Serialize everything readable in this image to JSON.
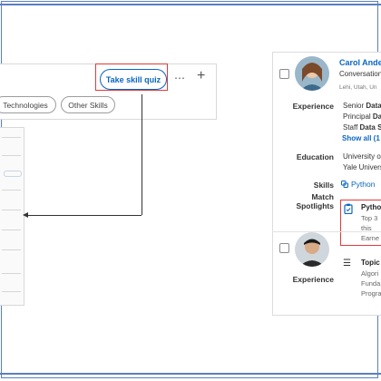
{
  "toolbar": {
    "quiz_button": "Take skill quiz",
    "more_symbol": "⋯",
    "plus_symbol": "+"
  },
  "skill_chips": [
    "Technologies",
    "Other Skills"
  ],
  "profile_1": {
    "name": "Carol Ande",
    "headline": "Conversation",
    "location": "Lehi, Utah, Un",
    "experience_label": "Experience",
    "experience": [
      {
        "prefix": "Senior ",
        "bold": "Data"
      },
      {
        "prefix": "Principal ",
        "bold": "Da"
      },
      {
        "prefix": "Staff ",
        "bold": "Data S"
      }
    ],
    "show_all": "Show all (1",
    "education_label": "Education",
    "education": [
      "University o",
      "Yale Univers"
    ],
    "skills_label": "Skills",
    "skill": "Python",
    "match_label_1": "Match",
    "match_label_2": "Spotlights",
    "spotlight": {
      "title": "Pytho",
      "lines": [
        "Top 3",
        "this",
        "Earne"
      ]
    }
  },
  "profile_2": {
    "experience_label": "Experience",
    "topic": {
      "title": "Topic",
      "lines": [
        "Algori",
        "Funda",
        "Progra"
      ]
    }
  },
  "colors": {
    "accent": "#0a66c2",
    "highlight": "#e03a3a",
    "frame": "#5b7fbf"
  }
}
